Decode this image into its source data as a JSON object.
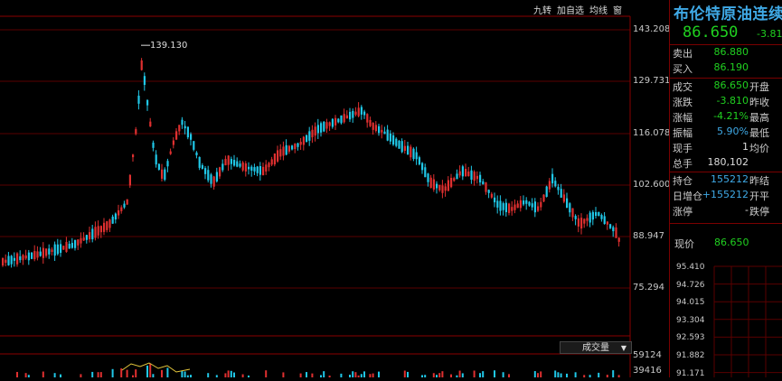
{
  "toolbar": {
    "items": [
      "九转",
      "加自选",
      "均线",
      "窗"
    ]
  },
  "price_axis": [
    "143.208",
    "129.731",
    "116.078",
    "102.600",
    "88.947",
    "75.294"
  ],
  "volume_axis": [
    "59124",
    "39416"
  ],
  "volume_selector": "成交量",
  "high_marker": "139.130",
  "panel": {
    "title": "布伦特原油连续",
    "price": "86.650",
    "change": "-3.81",
    "sell": {
      "label": "卖出",
      "value": "86.880"
    },
    "buy": {
      "label": "买入",
      "value": "86.190"
    },
    "rows": [
      {
        "label": "成交",
        "value": "86.650",
        "label2": "开盘",
        "color": "green"
      },
      {
        "label": "涨跌",
        "value": "-3.810",
        "label2": "昨收",
        "color": "green"
      },
      {
        "label": "涨幅",
        "value": "-4.21%",
        "label2": "最高",
        "color": "green"
      },
      {
        "label": "振幅",
        "value": "5.90%",
        "label2": "最低",
        "color": "cyan"
      },
      {
        "label": "现手",
        "value": "1",
        "label2": "均价",
        "color": "white"
      },
      {
        "label": "总手",
        "value": "180,102",
        "label2": "",
        "color": "white"
      }
    ],
    "rows2": [
      {
        "label": "持仓",
        "value": "155212",
        "label2": "昨结",
        "color": "cyan"
      },
      {
        "label": "日增仓",
        "value": "+155212",
        "label2": "开平",
        "color": "cyan"
      },
      {
        "label": "涨停",
        "value": "-",
        "label2": "跌停",
        "color": "white"
      }
    ],
    "current": {
      "label": "现价",
      "value": "86.650"
    },
    "mini_axis": [
      "95.410",
      "94.726",
      "94.015",
      "93.304",
      "92.593",
      "91.882",
      "91.171"
    ]
  },
  "colors": {
    "up": "#e03030",
    "down": "#20c8e8",
    "grid": "#5a0000",
    "green": "#20d020"
  }
}
